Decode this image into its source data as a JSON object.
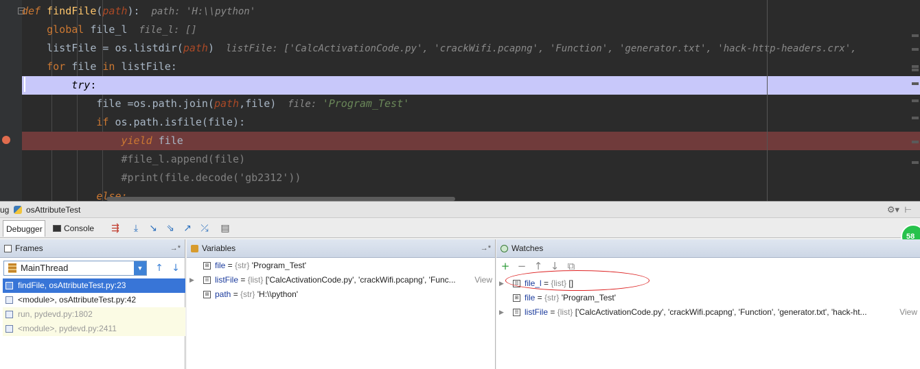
{
  "editor": {
    "lines": [
      [
        [
          "def ",
          "tok-kw-it"
        ],
        [
          "findFile",
          "tok-fn"
        ],
        [
          "(",
          ""
        ],
        [
          "path",
          "tok-param"
        ],
        [
          "):",
          ""
        ],
        [
          "  path: 'H:\\\\python'",
          "tok-inlay"
        ]
      ],
      [
        [
          "    ",
          ""
        ],
        [
          "global ",
          "tok-kw"
        ],
        [
          "file_l",
          ""
        ],
        [
          "  file_l: []",
          "tok-inlay"
        ]
      ],
      [
        [
          "    listFile = os.listdir(",
          ""
        ],
        [
          "path",
          "tok-param"
        ],
        [
          ")",
          ""
        ],
        [
          "  listFile: ['CalcActivationCode.py', 'crackWifi.pcapng', 'Function', 'generator.txt', 'hack-http-headers.crx',",
          "tok-inlay"
        ]
      ],
      [
        [
          "    ",
          ""
        ],
        [
          "for ",
          "tok-kw"
        ],
        [
          "file ",
          ""
        ],
        [
          "in ",
          "tok-kw"
        ],
        [
          "listFile:",
          ""
        ]
      ],
      [
        [
          "        ",
          ""
        ],
        [
          "try",
          "tok-kw-it"
        ],
        [
          ":",
          ""
        ]
      ],
      [
        [
          "            file =os.path.join(",
          ""
        ],
        [
          "path",
          "tok-param"
        ],
        [
          ",file)",
          ""
        ],
        [
          "  file: ",
          "tok-inlay"
        ],
        [
          "'Program_Test'",
          "tok-str"
        ]
      ],
      [
        [
          "            ",
          ""
        ],
        [
          "if ",
          "tok-kw"
        ],
        [
          "os.path.isfile(file):",
          ""
        ]
      ],
      [
        [
          "                ",
          ""
        ],
        [
          "yield ",
          "tok-kw-it"
        ],
        [
          "file",
          ""
        ]
      ],
      [
        [
          "                ",
          ""
        ],
        [
          "#file_l.append(file)",
          "tok-comment"
        ]
      ],
      [
        [
          "                ",
          ""
        ],
        [
          "#print(file.decode('gb2312'))",
          "tok-comment"
        ]
      ],
      [
        [
          "            ",
          ""
        ],
        [
          "else:",
          "tok-kw-it"
        ]
      ]
    ]
  },
  "panel": {
    "title_prefix": "ug",
    "config_name": "osAttributeTest",
    "tabs": {
      "debugger": "Debugger",
      "console": "Console"
    },
    "badge": "58"
  },
  "frames": {
    "title": "Frames",
    "thread": "MainThread",
    "items": [
      {
        "label": "findFile, osAttributeTest.py:23",
        "kind": "selected"
      },
      {
        "label": "<module>, osAttributeTest.py:42",
        "kind": "normal"
      },
      {
        "label": "run, pydevd.py:1802",
        "kind": "lib"
      },
      {
        "label": "<module>, pydevd.py:2411",
        "kind": "lib"
      }
    ]
  },
  "variables": {
    "title": "Variables",
    "items": [
      {
        "name": "file",
        "type": "{str}",
        "value": "'Program_Test'",
        "expandable": false,
        "view": ""
      },
      {
        "name": "listFile",
        "type": "{list}",
        "value": "['CalcActivationCode.py', 'crackWifi.pcapng', 'Func...",
        "expandable": true,
        "view": "View"
      },
      {
        "name": "path",
        "type": "{str}",
        "value": "'H:\\\\python'",
        "expandable": false,
        "view": ""
      }
    ]
  },
  "watches": {
    "title": "Watches",
    "items": [
      {
        "name": "file_l",
        "type": "{list}",
        "value": "[]",
        "expandable": true,
        "view": ""
      },
      {
        "name": "file",
        "type": "{str}",
        "value": "'Program_Test'",
        "expandable": false,
        "view": ""
      },
      {
        "name": "listFile",
        "type": "{list}",
        "value": "['CalcActivationCode.py', 'crackWifi.pcapng', 'Function', 'generator.txt', 'hack-ht...",
        "expandable": true,
        "view": "View"
      }
    ]
  },
  "colors": {
    "execution_line": "#c8c8fa",
    "breakpoint_line": "#703b3b",
    "selected_frame": "#3875d7",
    "annotation_ellipse": "#dd2222"
  }
}
